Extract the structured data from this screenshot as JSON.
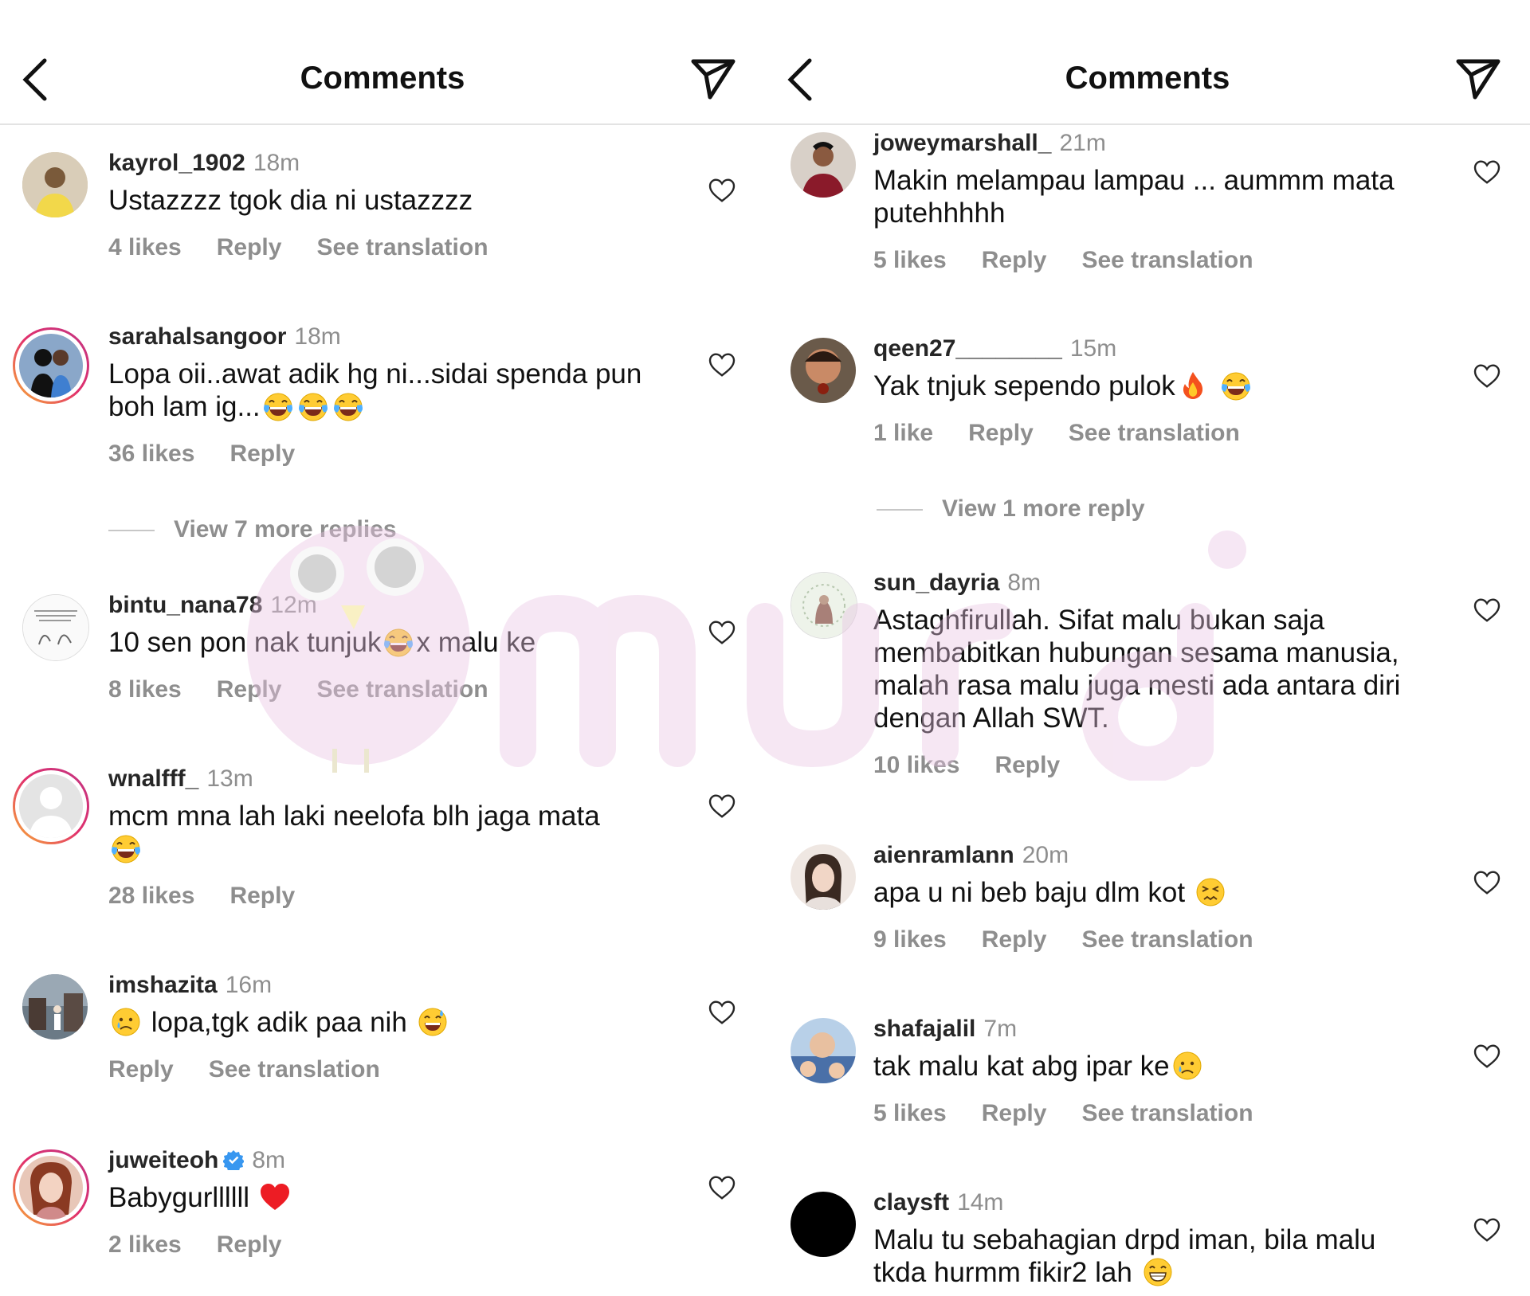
{
  "left": {
    "title": "Comments",
    "comments": [
      {
        "username": "kayrol_1902",
        "time": "18m",
        "text": "Ustazzzz tgok dia ni ustazzzz",
        "likes": "4 likes",
        "reply": "Reply",
        "translation": "See translation"
      },
      {
        "username": "sarahalsangoor",
        "time": "18m",
        "text": "Lopa oii..awat adik hg ni...sidai spenda pun boh lam ig...",
        "likes": "36 likes",
        "reply": "Reply"
      },
      {
        "view_more": "View 7 more replies"
      },
      {
        "username": "bintu_nana78",
        "time": "12m",
        "text_a": "10 sen pon nak tunjuk",
        "text_b": "x malu ke",
        "likes": "8 likes",
        "reply": "Reply",
        "translation": "See translation"
      },
      {
        "username": "wnalfff_",
        "time": "13m",
        "text": "mcm mna lah laki neelofa blh jaga mata",
        "likes": "28 likes",
        "reply": "Reply"
      },
      {
        "username": "imshazita",
        "time": "16m",
        "text": "lopa,tgk adik paa nih",
        "reply": "Reply",
        "translation": "See translation"
      },
      {
        "username": "juweiteoh",
        "time": "8m",
        "text": "Babygurllllll",
        "likes": "2 likes",
        "reply": "Reply"
      }
    ]
  },
  "right": {
    "title": "Comments",
    "comments": [
      {
        "username": "joweymarshall_",
        "time": "21m",
        "text": "Makin melampau lampau ... aummm mata putehhhhh",
        "likes": "5 likes",
        "reply": "Reply",
        "translation": "See translation"
      },
      {
        "username": "qeen27________",
        "time": "15m",
        "text": "Yak tnjuk  sependo pulok",
        "likes": "1 like",
        "reply": "Reply",
        "translation": "See translation"
      },
      {
        "view_more": "View 1 more reply"
      },
      {
        "username": "sun_dayria",
        "time": "8m",
        "text": "Astaghfirullah. Sifat malu bukan saja membabitkan hubungan sesama manusia, malah rasa malu juga mesti ada antara diri dengan Allah SWT.",
        "likes": "10 likes",
        "reply": "Reply"
      },
      {
        "username": "aienramlann",
        "time": "20m",
        "text": "apa u ni beb baju dlm kot",
        "likes": "9 likes",
        "reply": "Reply",
        "translation": "See translation"
      },
      {
        "username": "shafajalil",
        "time": "7m",
        "text": "tak malu kat abg ipar ke",
        "likes": "5 likes",
        "reply": "Reply",
        "translation": "See translation"
      },
      {
        "username": "claysft",
        "time": "14m",
        "text": "Malu tu sebahagian drpd iman, bila malu tkda hurmm fikir2 lah"
      }
    ]
  },
  "watermark": "murai",
  "colors": {
    "muted": "#8e8e8e",
    "heart_red": "#ed1c24",
    "verified": "#3897f0",
    "watermark": "#e9c4e3"
  }
}
